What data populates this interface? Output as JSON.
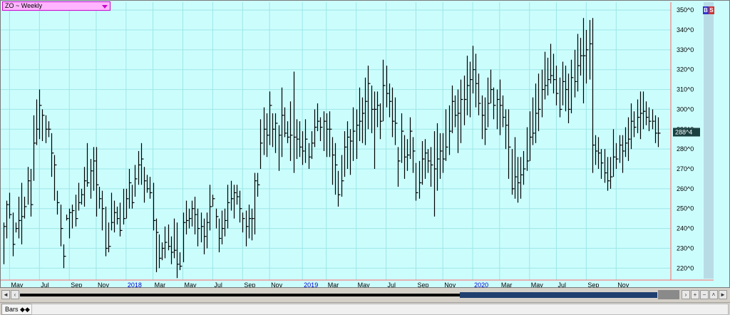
{
  "header": {
    "symbol_label": "ZO ~ Weekly"
  },
  "badge": {
    "b": "B",
    "s": "S"
  },
  "tabs": {
    "bars_label": "Bars",
    "bars_glyph": "◆◆"
  },
  "colors": {
    "background": "#ccfdfd",
    "grid": "#9ee6e6",
    "bars": "#000000",
    "price_tag": "#1a4040",
    "year_label": "#0000cc"
  },
  "chart_data": {
    "type": "ohlc",
    "title": "ZO ~ Weekly",
    "ylim": [
      214,
      354
    ],
    "yticks": [
      220,
      230,
      240,
      250,
      260,
      270,
      280,
      290,
      300,
      310,
      320,
      330,
      340,
      350
    ],
    "ytick_labels": [
      "220^0",
      "230^0",
      "240^0",
      "250^0",
      "260^0",
      "270^0",
      "280^0",
      "290^0",
      "300^0",
      "310^0",
      "320^0",
      "330^0",
      "340^0",
      "350^0"
    ],
    "last_price_label": "288^4",
    "last_price": 288.5,
    "x_labels": [
      {
        "label": "May",
        "index": 2,
        "year": false
      },
      {
        "label": "Jul",
        "index": 12,
        "year": false
      },
      {
        "label": "Sep",
        "index": 22,
        "year": false
      },
      {
        "label": "Nov",
        "index": 31,
        "year": false
      },
      {
        "label": "2018",
        "index": 41,
        "year": true
      },
      {
        "label": "Mar",
        "index": 50,
        "year": false
      },
      {
        "label": "May",
        "index": 60,
        "year": false
      },
      {
        "label": "Jul",
        "index": 70,
        "year": false
      },
      {
        "label": "Sep",
        "index": 80,
        "year": false
      },
      {
        "label": "Nov",
        "index": 89,
        "year": false
      },
      {
        "label": "2019",
        "index": 100,
        "year": true
      },
      {
        "label": "Mar",
        "index": 108,
        "year": false
      },
      {
        "label": "May",
        "index": 118,
        "year": false
      },
      {
        "label": "Jul",
        "index": 128,
        "year": false
      },
      {
        "label": "Sep",
        "index": 138,
        "year": false
      },
      {
        "label": "Nov",
        "index": 147,
        "year": false
      },
      {
        "label": "2020",
        "index": 157,
        "year": true
      },
      {
        "label": "Mar",
        "index": 166,
        "year": false
      },
      {
        "label": "May",
        "index": 176,
        "year": false
      },
      {
        "label": "Jul",
        "index": 185,
        "year": false
      },
      {
        "label": "Sep",
        "index": 195,
        "year": false
      },
      {
        "label": "Nov",
        "index": 205,
        "year": false
      }
    ],
    "bars": [
      [
        222,
        243,
        241
      ],
      [
        235,
        254,
        252
      ],
      [
        245,
        258,
        247
      ],
      [
        226,
        248,
        232
      ],
      [
        238,
        243,
        240
      ],
      [
        235,
        256,
        244
      ],
      [
        232,
        263,
        246
      ],
      [
        245,
        256,
        251
      ],
      [
        252,
        271,
        264
      ],
      [
        246,
        270,
        252
      ],
      [
        264,
        297,
        283
      ],
      [
        282,
        305,
        290
      ],
      [
        285,
        310,
        302
      ],
      [
        284,
        300,
        297
      ],
      [
        283,
        297,
        290
      ],
      [
        286,
        294,
        290
      ],
      [
        266,
        288,
        278
      ],
      [
        254,
        277,
        272
      ],
      [
        247,
        259,
        253
      ],
      [
        231,
        252,
        240
      ],
      [
        220,
        232,
        226
      ],
      [
        244,
        247,
        245
      ],
      [
        235,
        250,
        248
      ],
      [
        240,
        252,
        249
      ],
      [
        241,
        257,
        245
      ],
      [
        249,
        263,
        253
      ],
      [
        252,
        260,
        257
      ],
      [
        251,
        271,
        264
      ],
      [
        261,
        283,
        263
      ],
      [
        255,
        275,
        269
      ],
      [
        259,
        281,
        274
      ],
      [
        246,
        281,
        262
      ],
      [
        250,
        261,
        255
      ],
      [
        239,
        259,
        250
      ],
      [
        226,
        251,
        230
      ],
      [
        228,
        243,
        231
      ],
      [
        239,
        258,
        243
      ],
      [
        238,
        254,
        248
      ],
      [
        242,
        251,
        245
      ],
      [
        236,
        253,
        239
      ],
      [
        242,
        260,
        245
      ],
      [
        245,
        260,
        255
      ],
      [
        250,
        270,
        263
      ],
      [
        250,
        262,
        253
      ],
      [
        256,
        272,
        265
      ],
      [
        262,
        279,
        272
      ],
      [
        262,
        283,
        275
      ],
      [
        253,
        271,
        264
      ],
      [
        258,
        267,
        260
      ],
      [
        255,
        266,
        258
      ],
      [
        239,
        263,
        244
      ],
      [
        218,
        245,
        238
      ],
      [
        220,
        237,
        225
      ],
      [
        224,
        233,
        230
      ],
      [
        225,
        241,
        233
      ],
      [
        229,
        242,
        231
      ],
      [
        222,
        236,
        228
      ],
      [
        225,
        245,
        229
      ],
      [
        215,
        243,
        222
      ],
      [
        219,
        228,
        221
      ],
      [
        223,
        248,
        243
      ],
      [
        237,
        254,
        244
      ],
      [
        240,
        250,
        245
      ],
      [
        241,
        254,
        250
      ],
      [
        237,
        256,
        247
      ],
      [
        231,
        250,
        240
      ],
      [
        233,
        248,
        241
      ],
      [
        227,
        245,
        236
      ],
      [
        230,
        248,
        243
      ],
      [
        239,
        262,
        251
      ],
      [
        251,
        257,
        255
      ],
      [
        240,
        250,
        246
      ],
      [
        228,
        245,
        235
      ],
      [
        232,
        249,
        240
      ],
      [
        236,
        250,
        244
      ],
      [
        240,
        262,
        253
      ],
      [
        249,
        264,
        255
      ],
      [
        245,
        262,
        258
      ],
      [
        252,
        262,
        256
      ],
      [
        243,
        259,
        250
      ],
      [
        238,
        248,
        245
      ],
      [
        231,
        249,
        241
      ],
      [
        235,
        252,
        245
      ],
      [
        234,
        250,
        245
      ],
      [
        237,
        268,
        264
      ],
      [
        256,
        268,
        262
      ],
      [
        270,
        295,
        283
      ],
      [
        277,
        301,
        290
      ],
      [
        276,
        298,
        287
      ],
      [
        282,
        309,
        302
      ],
      [
        281,
        298,
        290
      ],
      [
        278,
        298,
        293
      ],
      [
        269,
        292,
        287
      ],
      [
        276,
        311,
        297
      ],
      [
        286,
        301,
        288
      ],
      [
        283,
        294,
        286
      ],
      [
        274,
        304,
        287
      ],
      [
        268,
        319,
        286
      ],
      [
        275,
        295,
        285
      ],
      [
        276,
        294,
        281
      ],
      [
        272,
        289,
        279
      ],
      [
        273,
        295,
        285
      ],
      [
        270,
        283,
        276
      ],
      [
        275,
        289,
        283
      ],
      [
        281,
        300,
        291
      ],
      [
        289,
        303,
        294
      ],
      [
        284,
        296,
        291
      ],
      [
        279,
        299,
        294
      ],
      [
        276,
        298,
        290
      ],
      [
        276,
        299,
        290
      ],
      [
        262,
        286,
        277
      ],
      [
        257,
        283,
        272
      ],
      [
        251,
        269,
        257
      ],
      [
        256,
        277,
        264
      ],
      [
        266,
        289,
        281
      ],
      [
        270,
        294,
        286
      ],
      [
        267,
        290,
        284
      ],
      [
        274,
        301,
        289
      ],
      [
        275,
        300,
        292
      ],
      [
        284,
        311,
        294
      ],
      [
        283,
        306,
        298
      ],
      [
        282,
        316,
        304
      ],
      [
        290,
        322,
        313
      ],
      [
        288,
        312,
        300
      ],
      [
        270,
        309,
        300
      ],
      [
        291,
        309,
        302
      ],
      [
        285,
        303,
        294
      ],
      [
        294,
        325,
        312
      ],
      [
        301,
        322,
        308
      ],
      [
        296,
        313,
        304
      ],
      [
        286,
        311,
        294
      ],
      [
        282,
        306,
        293
      ],
      [
        261,
        281,
        274
      ],
      [
        273,
        298,
        289
      ],
      [
        265,
        287,
        276
      ],
      [
        269,
        285,
        277
      ],
      [
        275,
        296,
        289
      ],
      [
        268,
        286,
        279
      ],
      [
        254,
        273,
        258
      ],
      [
        255,
        274,
        263
      ],
      [
        262,
        284,
        275
      ],
      [
        265,
        285,
        278
      ],
      [
        268,
        280,
        274
      ],
      [
        261,
        281,
        272
      ],
      [
        246,
        289,
        270
      ],
      [
        259,
        293,
        275
      ],
      [
        265,
        288,
        279
      ],
      [
        268,
        288,
        275
      ],
      [
        274,
        300,
        281
      ],
      [
        277,
        302,
        289
      ],
      [
        288,
        312,
        304
      ],
      [
        291,
        307,
        297
      ],
      [
        278,
        310,
        298
      ],
      [
        283,
        315,
        305
      ],
      [
        292,
        317,
        305
      ],
      [
        297,
        327,
        312
      ],
      [
        296,
        324,
        315
      ],
      [
        308,
        332,
        320
      ],
      [
        301,
        328,
        313
      ],
      [
        297,
        318,
        303
      ],
      [
        285,
        307,
        297
      ],
      [
        282,
        306,
        290
      ],
      [
        291,
        316,
        303
      ],
      [
        303,
        320,
        310
      ],
      [
        295,
        311,
        302
      ],
      [
        290,
        310,
        305
      ],
      [
        287,
        315,
        302
      ],
      [
        291,
        307,
        296
      ],
      [
        280,
        300,
        292
      ],
      [
        265,
        300,
        281
      ],
      [
        257,
        280,
        260
      ],
      [
        255,
        286,
        266
      ],
      [
        253,
        276,
        263
      ],
      [
        255,
        276,
        267
      ],
      [
        262,
        279,
        270
      ],
      [
        269,
        291,
        274
      ],
      [
        274,
        299,
        286
      ],
      [
        282,
        306,
        288
      ],
      [
        283,
        313,
        298
      ],
      [
        289,
        318,
        300
      ],
      [
        296,
        320,
        310
      ],
      [
        305,
        329,
        312
      ],
      [
        307,
        326,
        315
      ],
      [
        313,
        333,
        317
      ],
      [
        308,
        328,
        315
      ],
      [
        302,
        322,
        308
      ],
      [
        296,
        316,
        300
      ],
      [
        302,
        324,
        314
      ],
      [
        299,
        322,
        310
      ],
      [
        293,
        318,
        300
      ],
      [
        298,
        325,
        316
      ],
      [
        306,
        330,
        314
      ],
      [
        309,
        338,
        322
      ],
      [
        317,
        336,
        327
      ],
      [
        303,
        346,
        327
      ],
      [
        313,
        340,
        330
      ],
      [
        315,
        345,
        333
      ],
      [
        268,
        346,
        282
      ],
      [
        272,
        287,
        279
      ],
      [
        270,
        286,
        278
      ],
      [
        265,
        280,
        273
      ],
      [
        263,
        280,
        268
      ],
      [
        259,
        276,
        264
      ],
      [
        260,
        276,
        266
      ],
      [
        266,
        290,
        276
      ],
      [
        270,
        283,
        275
      ],
      [
        273,
        287,
        282
      ],
      [
        268,
        287,
        279
      ],
      [
        276,
        291,
        283
      ],
      [
        274,
        296,
        285
      ],
      [
        280,
        303,
        294
      ],
      [
        286,
        299,
        291
      ],
      [
        288,
        305,
        296
      ],
      [
        285,
        309,
        298
      ],
      [
        290,
        309,
        299
      ],
      [
        292,
        304,
        296
      ],
      [
        289,
        301,
        294
      ],
      [
        290,
        300,
        294
      ],
      [
        283,
        297,
        288
      ],
      [
        281,
        296,
        288
      ]
    ]
  }
}
